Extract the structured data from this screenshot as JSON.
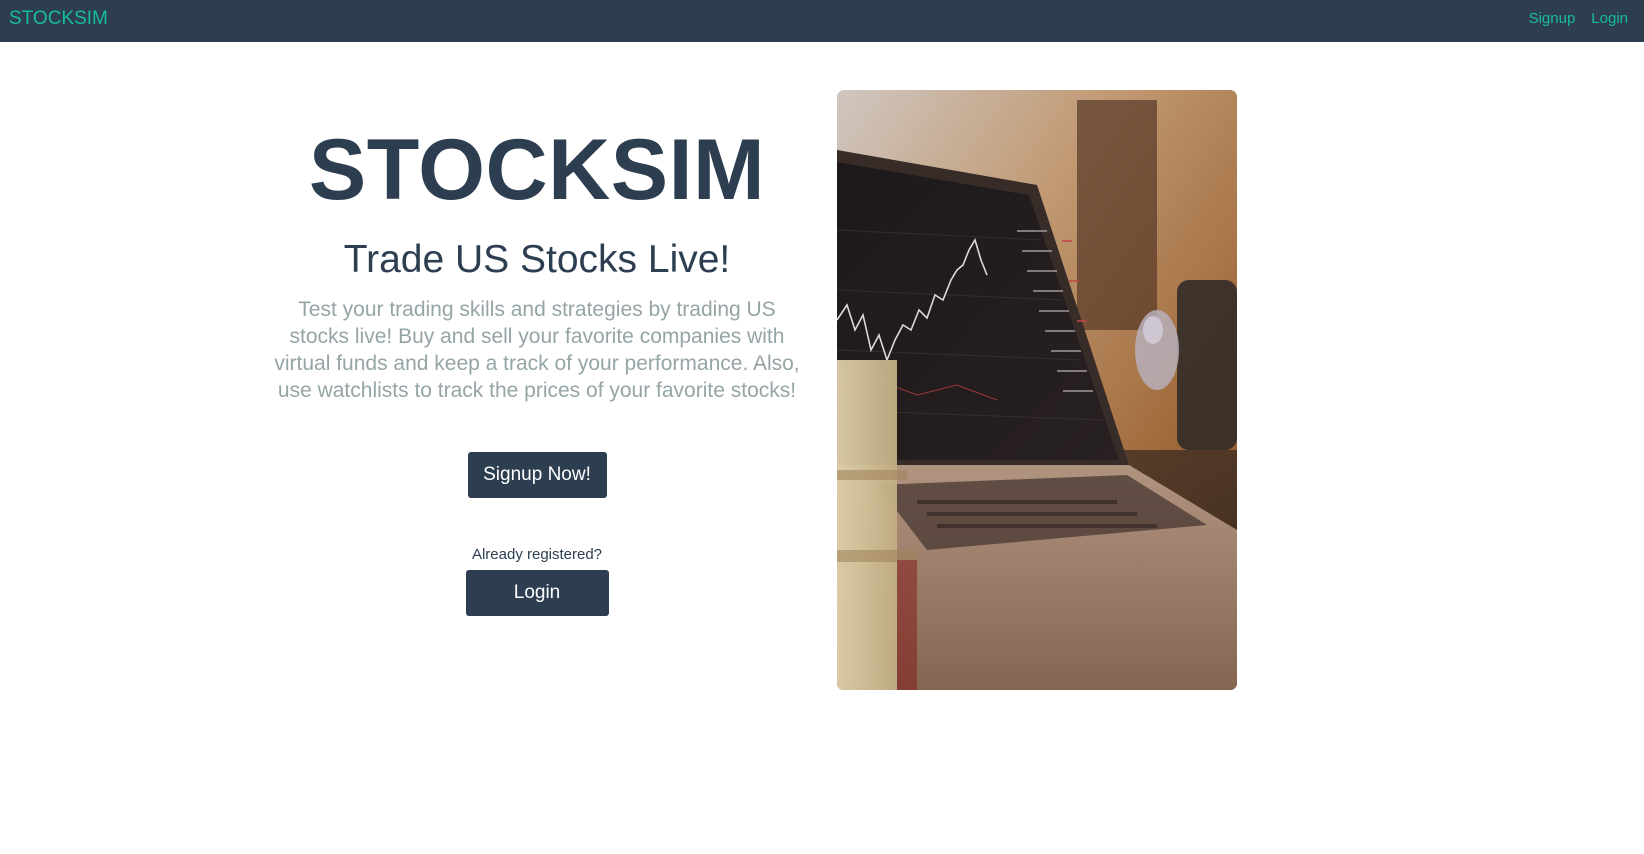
{
  "navbar": {
    "brand": "STOCKSIM",
    "links": {
      "signup": "Signup",
      "login": "Login"
    },
    "colors": {
      "background": "#2c3e50",
      "link": "#18bc9c"
    }
  },
  "hero": {
    "title": "STOCKSIM",
    "subtitle": "Trade US Stocks Live!",
    "description": "Test your trading skills and strategies by trading US stocks live! Buy and sell your favorite companies with virtual funds and keep a track of your performance. Also, use watchlists to track the prices of your favorite stocks!",
    "signup_button": "Signup Now!",
    "already_registered": "Already registered?",
    "login_button": "Login"
  },
  "image": {
    "semantic": "laptop-with-stock-chart-photo",
    "alt": "Laptop showing a stock trading chart on a desk"
  },
  "colors": {
    "primary": "#2c3e50",
    "accent": "#18bc9c",
    "muted_text": "#95a5a6"
  }
}
